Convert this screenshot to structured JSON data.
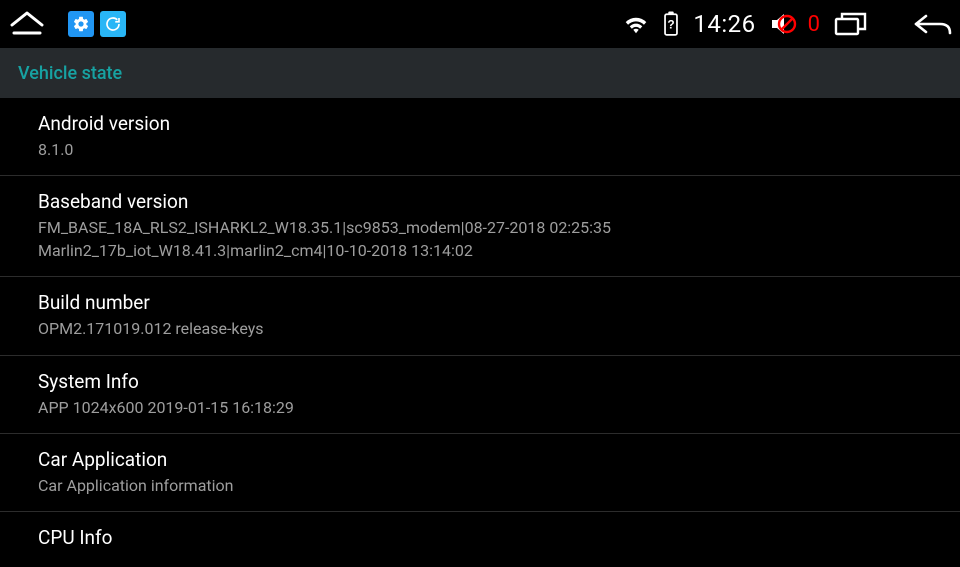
{
  "statusbar": {
    "clock": "14:26",
    "volume_badge": "0"
  },
  "header": {
    "title": "Vehicle state"
  },
  "items": [
    {
      "title": "Android version",
      "sub": "8.1.0"
    },
    {
      "title": "Baseband version",
      "sub": "FM_BASE_18A_RLS2_ISHARKL2_W18.35.1|sc9853_modem|08-27-2018 02:25:35\nMarlin2_17b_iot_W18.41.3|marlin2_cm4|10-10-2018 13:14:02"
    },
    {
      "title": "Build number",
      "sub": "OPM2.171019.012 release-keys"
    },
    {
      "title": "System Info",
      "sub": "APP 1024x600 2019-01-15 16:18:29"
    },
    {
      "title": "Car Application",
      "sub": "Car Application information"
    },
    {
      "title": "CPU Info",
      "sub": ""
    }
  ]
}
